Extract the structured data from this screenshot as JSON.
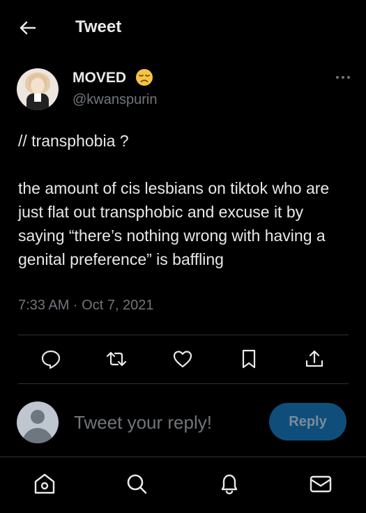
{
  "header": {
    "title": "Tweet"
  },
  "author": {
    "display_name": "MOVED",
    "handle": "@kwanspurin"
  },
  "tweet": {
    "text": "// transphobia ?\n\nthe amount of cis lesbians on tiktok who are just flat out transphobic and excuse it by saying “there’s nothing wrong with having a genital preference” is baffling",
    "timestamp": "7:33 AM · Oct 7, 2021"
  },
  "actions": [
    "reply-icon",
    "retweet-icon",
    "like-icon",
    "bookmark-icon",
    "share-icon"
  ],
  "reply": {
    "placeholder": "Tweet your reply!",
    "button_label": "Reply"
  },
  "bottom_nav": [
    "home-icon",
    "search-icon",
    "notifications-icon",
    "messages-icon"
  ],
  "colors": {
    "background": "#000000",
    "text": "#e7e9ea",
    "muted": "#71767b",
    "divider": "#2f3336",
    "reply_button": "#0f4e7b"
  }
}
